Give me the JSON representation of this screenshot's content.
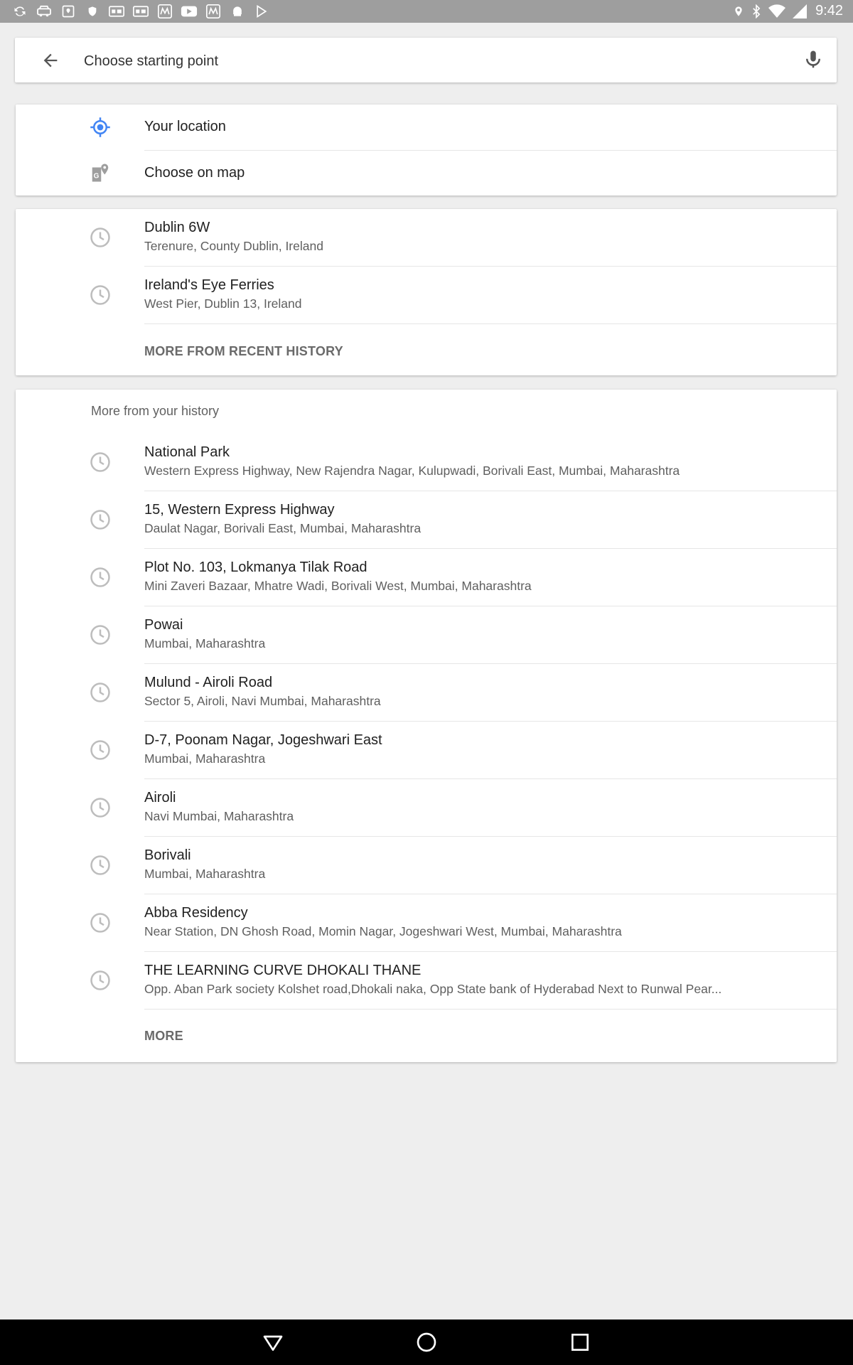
{
  "status_bar": {
    "time": "9:42",
    "left_icons": [
      "sync-icon",
      "car-icon",
      "maps-icon",
      "shield-icon",
      "gif-icon",
      "gif-icon",
      "myntra-icon",
      "youtube-icon",
      "myntra-icon",
      "android-icon",
      "play-store-icon"
    ],
    "right_icons": [
      "location-icon",
      "bluetooth-icon",
      "wifi-icon",
      "signal-icon"
    ]
  },
  "search": {
    "placeholder": "Choose starting point",
    "value": ""
  },
  "quick_options": {
    "your_location": "Your location",
    "choose_on_map": "Choose on map",
    "accent_color": "#4285f4"
  },
  "recent": {
    "items": [
      {
        "title": "Dublin 6W",
        "subtitle": "Terenure, County Dublin, Ireland"
      },
      {
        "title": "Ireland's Eye Ferries",
        "subtitle": "West Pier, Dublin 13, Ireland"
      }
    ],
    "more_label": "MORE FROM RECENT HISTORY"
  },
  "history": {
    "header": "More from your history",
    "items": [
      {
        "title": "National Park",
        "subtitle": "Western Express Highway, New Rajendra Nagar, Kulupwadi, Borivali East, Mumbai, Maharashtra"
      },
      {
        "title": "15, Western Express Highway",
        "subtitle": "Daulat Nagar, Borivali East, Mumbai, Maharashtra"
      },
      {
        "title": "Plot No. 103, Lokmanya Tilak Road",
        "subtitle": "Mini Zaveri Bazaar, Mhatre Wadi, Borivali West, Mumbai, Maharashtra"
      },
      {
        "title": "Powai",
        "subtitle": "Mumbai, Maharashtra"
      },
      {
        "title": "Mulund - Airoli Road",
        "subtitle": "Sector 5, Airoli, Navi Mumbai, Maharashtra"
      },
      {
        "title": "D-7, Poonam Nagar, Jogeshwari East",
        "subtitle": "Mumbai, Maharashtra"
      },
      {
        "title": "Airoli",
        "subtitle": "Navi Mumbai, Maharashtra"
      },
      {
        "title": "Borivali",
        "subtitle": "Mumbai, Maharashtra"
      },
      {
        "title": "Abba Residency",
        "subtitle": "Near Station, DN Ghosh Road, Momin Nagar, Jogeshwari West, Mumbai, Maharashtra"
      },
      {
        "title": "THE LEARNING CURVE DHOKALI THANE",
        "subtitle": "Opp. Aban Park society Kolshet road,Dhokali naka, Opp State bank of Hyderabad Next to Runwal Pear..."
      }
    ],
    "more_label": "MORE"
  },
  "nav_bar": {
    "buttons": [
      "back-triangle-icon",
      "home-circle-icon",
      "recents-square-icon"
    ]
  }
}
